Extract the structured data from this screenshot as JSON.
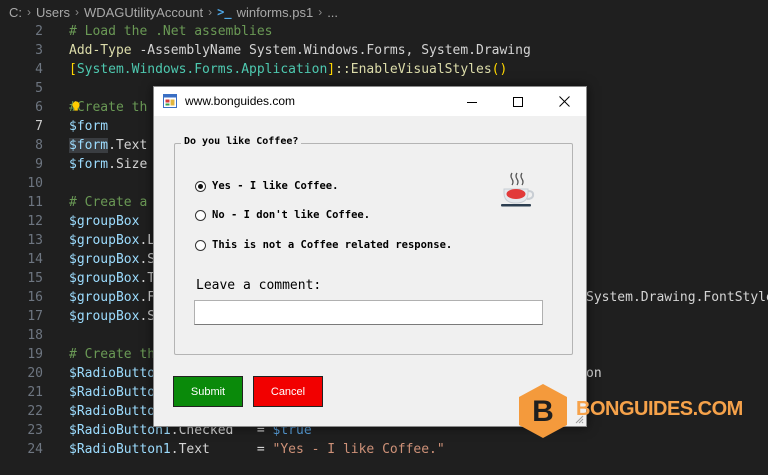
{
  "breadcrumb": {
    "items": [
      "C:",
      "Users",
      "WDAGUtilityAccount",
      "winforms.ps1",
      "..."
    ],
    "ps_icon": ">_"
  },
  "editor": {
    "lines": [
      {
        "n": "2"
      },
      {
        "n": "3"
      },
      {
        "n": "4"
      },
      {
        "n": "5"
      },
      {
        "n": "6"
      },
      {
        "n": "7"
      },
      {
        "n": "8"
      },
      {
        "n": "9"
      },
      {
        "n": "10"
      },
      {
        "n": "11"
      },
      {
        "n": "12"
      },
      {
        "n": "13"
      },
      {
        "n": "14"
      },
      {
        "n": "15"
      },
      {
        "n": "16"
      },
      {
        "n": "17"
      },
      {
        "n": "18"
      },
      {
        "n": "19"
      },
      {
        "n": "20"
      },
      {
        "n": "21"
      },
      {
        "n": "22"
      },
      {
        "n": "23"
      },
      {
        "n": "24"
      }
    ],
    "code": {
      "l2": "# Load the .Net assemblies",
      "l3_cmd": "Add-Type",
      "l3_rest": " -AssemblyName System.Windows.Forms, System.Drawing",
      "l4_open": "[",
      "l4_type": "System.Windows.Forms.Application",
      "l4_close": "]",
      "l4_rest": "::EnableVisualStyles",
      "l4_paren": "()",
      "l6": "#Create th",
      "l7": "$form",
      "l8_var": "$form",
      "l8_rest": ".Text",
      "l9_var": "$form",
      "l9_rest": ".Size",
      "l11": "# Create a",
      "l12": "$groupBox",
      "l13_var": "$groupBox",
      "l13_rest": ".L",
      "l14_var": "$groupBox",
      "l14_rest": ".S",
      "l15_var": "$groupBox",
      "l15_rest": ".T",
      "l16_var": "$groupBox",
      "l16_rest": ".F",
      "l16_tail": "System.Drawing.FontStyle",
      "l17_var": "$groupBox",
      "l17_rest": ".S",
      "l19": "# Create th",
      "l20_var": "$RadioButto",
      "l20_tail": "on",
      "l21_var": "$RadioButto",
      "l22_var": "$RadioButto",
      "l23_var": "$RadioButton1",
      "l23_rest": ".Checked",
      "l23_eq": "   = ",
      "l23_val": "$true",
      "l24_var": "$RadioButton1",
      "l24_rest": ".Text",
      "l24_eq": "      = ",
      "l24_val": "\"Yes - I like Coffee.\""
    }
  },
  "window": {
    "title": "www.bonguides.com",
    "group_title": "Do you like Coffee?",
    "radios": [
      {
        "label": "Yes - I like Coffee.",
        "checked": true
      },
      {
        "label": "No - I don't like Coffee.",
        "checked": false
      },
      {
        "label": "This is not a Coffee related response.",
        "checked": false
      }
    ],
    "comment_label": "Leave a comment:",
    "comment_value": "",
    "submit_label": "Submit",
    "cancel_label": "Cancel",
    "colors": {
      "submit": "#0a8a0a",
      "cancel": "#f20000"
    }
  },
  "watermark": {
    "text": "BONGUIDES.COM",
    "color": "#f6a24a"
  }
}
